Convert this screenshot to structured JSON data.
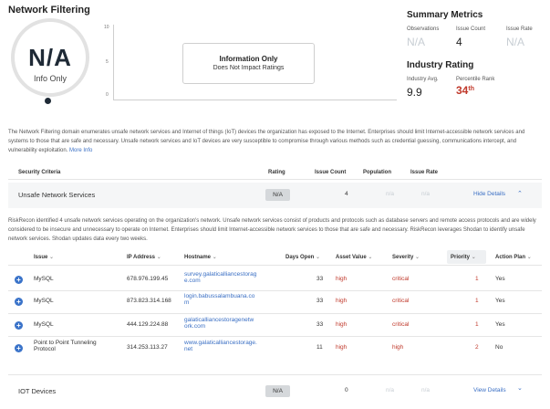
{
  "page_title": "Network Filtering",
  "gauge": {
    "value": "N/A",
    "sublabel": "Info Only"
  },
  "trend_chart": {
    "y_ticks": [
      "10",
      "5",
      "0"
    ],
    "overlay_title": "Information Only",
    "overlay_subtitle": "Does Not Impact Ratings"
  },
  "summary": {
    "title": "Summary Metrics",
    "observations_label": "Observations",
    "observations_value": "N/A",
    "issue_count_label": "Issue Count",
    "issue_count_value": "4",
    "issue_rate_label": "Issue Rate",
    "issue_rate_value": "N/A"
  },
  "industry": {
    "title": "Industry Rating",
    "avg_label": "Industry Avg.",
    "avg_value": "9.9",
    "rank_label": "Percentile Rank",
    "rank_value": "34",
    "rank_suffix": "th"
  },
  "description": {
    "text": "The Network Filtering domain enumerates unsafe network services and Internet of things (IoT) devices the organization has exposed to the Internet. Enterprises should limit Internet-accessible network services and systems to those that are safe and necessary. Unsafe network services and IoT devices are very susceptible to compromise through various methods such as credential guessing, communications intercept, and vulnerability exploitation.",
    "more_link": "More Info"
  },
  "criteria_table": {
    "headers": {
      "criteria": "Security Criteria",
      "rating": "Rating",
      "issue_count": "Issue Count",
      "population": "Population",
      "issue_rate": "Issue Rate"
    }
  },
  "unsafe_services": {
    "name": "Unsafe Network Services",
    "rating": "N/A",
    "issue_count": "4",
    "population": "n/a",
    "issue_rate": "n/a",
    "toggle_label": "Hide Details",
    "detail_text": "RiskRecon identified 4 unsafe network services operating on the organization's network. Unsafe network services consist of products and protocols such as database servers and remote access protocols and are widely considered to be insecure and unnecessary to operate on Internet. Enterprises should limit Internet-accessible network services to those that are safe and necessary. RiskRecon leverages Shodan to identify unsafe network services. Shodan updates data every two weeks."
  },
  "issues_table": {
    "headers": {
      "issue": "Issue",
      "ip": "IP Address",
      "hostname": "Hostname",
      "days_open": "Days Open",
      "asset_value": "Asset Value",
      "severity": "Severity",
      "priority": "Priority",
      "action_plan": "Action Plan"
    },
    "rows": [
      {
        "issue": "MySQL",
        "ip": "678.976.199.45",
        "host1": "survey.galaticalliancestorag",
        "host2": "e.com",
        "days": "33",
        "asset": "high",
        "severity": "critical",
        "priority": "1",
        "action": "Yes"
      },
      {
        "issue": "MySQL",
        "ip": "873.823.314.168",
        "host1": "login.babussalambuana.co",
        "host2": "m",
        "days": "33",
        "asset": "high",
        "severity": "critical",
        "priority": "1",
        "action": "Yes"
      },
      {
        "issue": "MySQL",
        "ip": "444.129.224.88",
        "host1": "galaticalliancestoragenetw",
        "host2": "ork.com",
        "days": "33",
        "asset": "high",
        "severity": "critical",
        "priority": "1",
        "action": "Yes"
      },
      {
        "issue1": "Point to Point Tunneling",
        "issue2": "Protocol",
        "ip": "314.253.113.27",
        "host1": "www.galaticalliancestorage.",
        "host2": "net",
        "days": "11",
        "asset": "high",
        "severity": "high",
        "priority": "2",
        "action": "No"
      }
    ]
  },
  "iot": {
    "name": "IOT Devices",
    "rating": "N/A",
    "issue_count": "0",
    "population": "n/a",
    "issue_rate": "n/a",
    "toggle_label": "View Details"
  },
  "colors": {
    "accent": "#3a6fc4",
    "danger": "#c0392b",
    "muted": "#c7cdd3"
  }
}
